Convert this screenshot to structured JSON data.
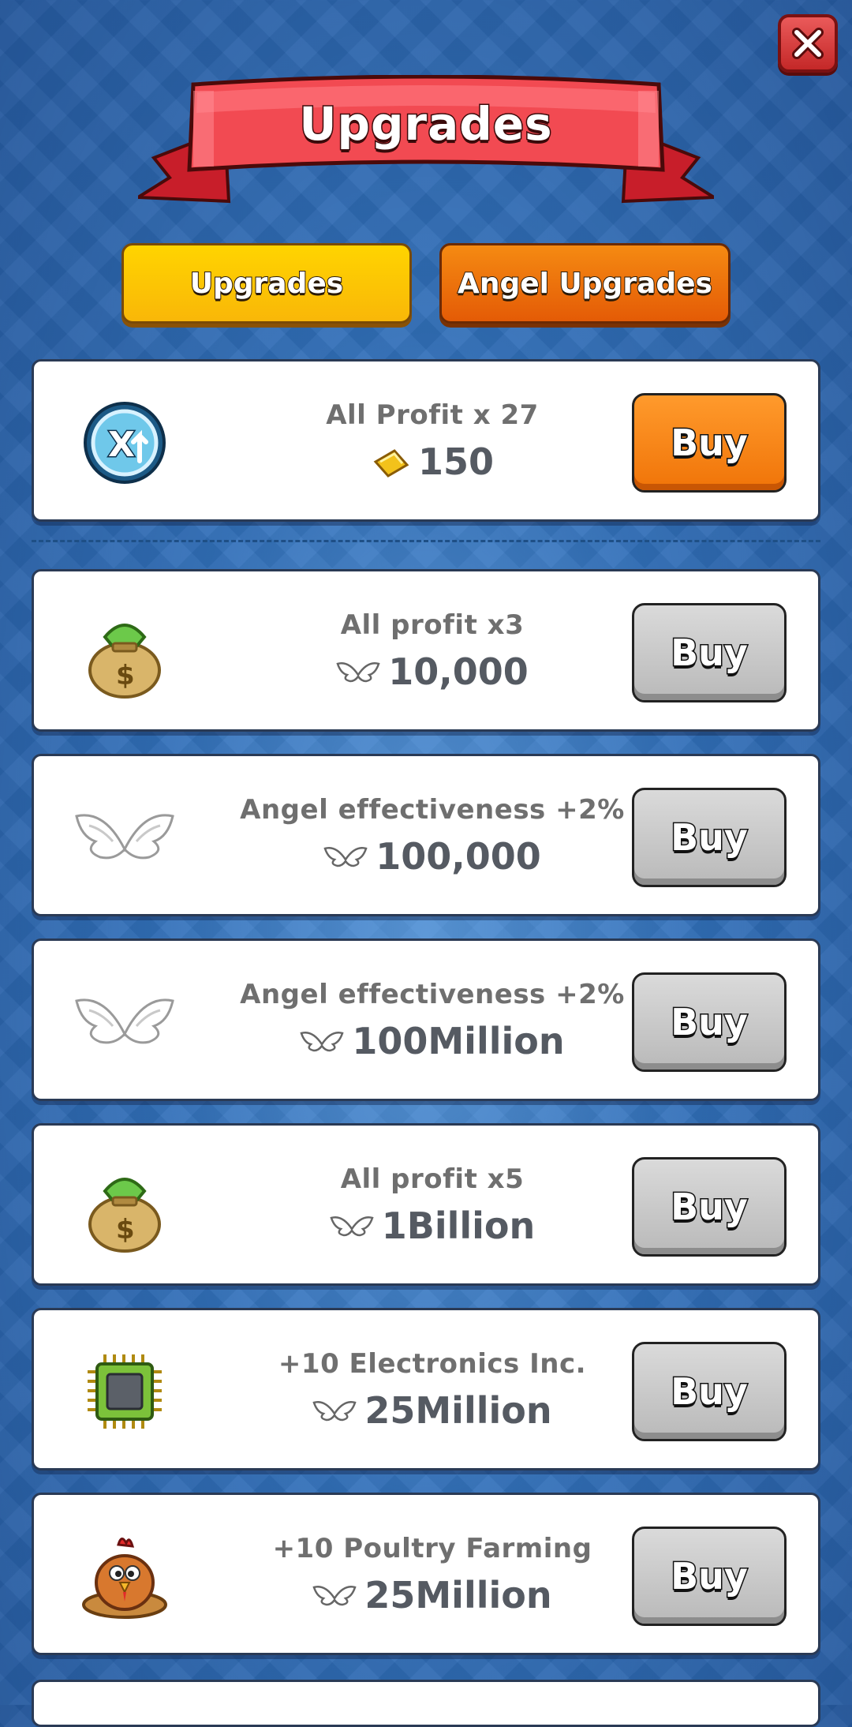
{
  "header": {
    "title": "Upgrades"
  },
  "tabs": [
    {
      "label": "Upgrades"
    },
    {
      "label": "Angel Upgrades"
    }
  ],
  "upgrades": [
    {
      "name": "All Profit x 27",
      "cost": "150",
      "currency_icon": "gold-bar-icon",
      "icon": "x-up-badge-icon",
      "buy_label": "Buy",
      "button_color": "#f78a1a"
    },
    {
      "name": "All profit x3",
      "cost": "10,000",
      "currency_icon": "angel-wings-icon",
      "icon": "money-bag-icon",
      "buy_label": "Buy",
      "button_color": "#c8c8c8"
    },
    {
      "name": "Angel effectiveness +2%",
      "cost": "100,000",
      "currency_icon": "angel-wings-icon",
      "icon": "wings-icon",
      "buy_label": "Buy",
      "button_color": "#c8c8c8"
    },
    {
      "name": "Angel effectiveness +2%",
      "cost": "100Million",
      "currency_icon": "angel-wings-icon",
      "icon": "wings-icon",
      "buy_label": "Buy",
      "button_color": "#c8c8c8"
    },
    {
      "name": "All profit x5",
      "cost": "1Billion",
      "currency_icon": "angel-wings-icon",
      "icon": "money-bag-icon",
      "buy_label": "Buy",
      "button_color": "#c8c8c8"
    },
    {
      "name": "+10 Electronics Inc.",
      "cost": "25Million",
      "currency_icon": "angel-wings-icon",
      "icon": "chip-icon",
      "buy_label": "Buy",
      "button_color": "#c8c8c8"
    },
    {
      "name": "+10 Poultry Farming",
      "cost": "25Million",
      "currency_icon": "angel-wings-icon",
      "icon": "chicken-icon",
      "buy_label": "Buy",
      "button_color": "#c8c8c8"
    }
  ]
}
